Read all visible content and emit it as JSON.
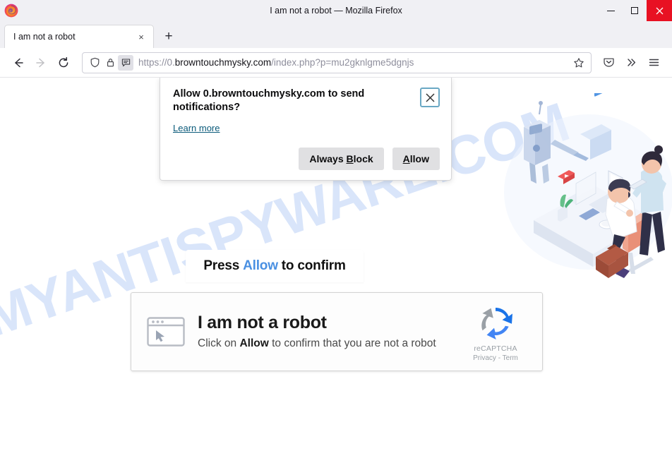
{
  "window": {
    "title": "I am not a robot — Mozilla Firefox",
    "minimize_label": "Minimize",
    "maximize_label": "Maximize",
    "close_label": "Close",
    "logo_icon": "firefox-logo-icon"
  },
  "tabs": {
    "items": [
      {
        "label": "I am not a robot",
        "close_glyph": "×"
      }
    ],
    "new_tab_glyph": "+",
    "new_tab_label": "Open a new tab"
  },
  "toolbar": {
    "back_label": "Go back one page",
    "forward_label": "Go forward one page",
    "reload_label": "Reload current page",
    "pocket_label": "Save to Pocket",
    "overflow_label": "More tools",
    "menu_label": "Open application menu",
    "bookmark_label": "Bookmark this page"
  },
  "urlbar": {
    "scheme": "https://0.",
    "host": "browntouchmysky.com",
    "path": "/index.php?p=mu2gknlgme5dgnjs",
    "full_url": "https://0.browntouchmysky.com/index.php?p=mu2gknlgme5dgnjs",
    "shield_icon": "tracking-protection-shield-icon",
    "lock_icon": "padlock-icon",
    "notifications_icon": "notification-permission-icon",
    "star_icon": "bookmark-star-icon"
  },
  "permission_popup": {
    "question": "Allow 0.browntouchmysky.com to send notifications?",
    "learn_more": "Learn more",
    "always_block_pre": "Always ",
    "always_block_accel": "B",
    "always_block_post": "lock",
    "allow_accel": "A",
    "allow_post": "llow",
    "close_glyph": "×",
    "close_label": "Close notification prompt",
    "focus_border_color": "#6aa8c4"
  },
  "page": {
    "press_banner": {
      "before": "Press",
      "highlight": "Allow",
      "after": "to confirm",
      "highlight_color": "#4a90e2"
    },
    "captcha_card": {
      "icon": "browser-window-cursor-icon",
      "title": "I am not a robot",
      "subtitle_before": "Click on ",
      "subtitle_bold": "Allow",
      "subtitle_after": " to confirm that you are not a robot",
      "recaptcha_name": "reCAPTCHA",
      "recaptcha_terms": "Privacy - Term",
      "recaptcha_icon": "recaptcha-logo-icon"
    },
    "watermark": "MYANTISPYWARE.COM",
    "watermark_color": "#c3d6f7",
    "illustration": "isometric-office-robot-illustration"
  }
}
